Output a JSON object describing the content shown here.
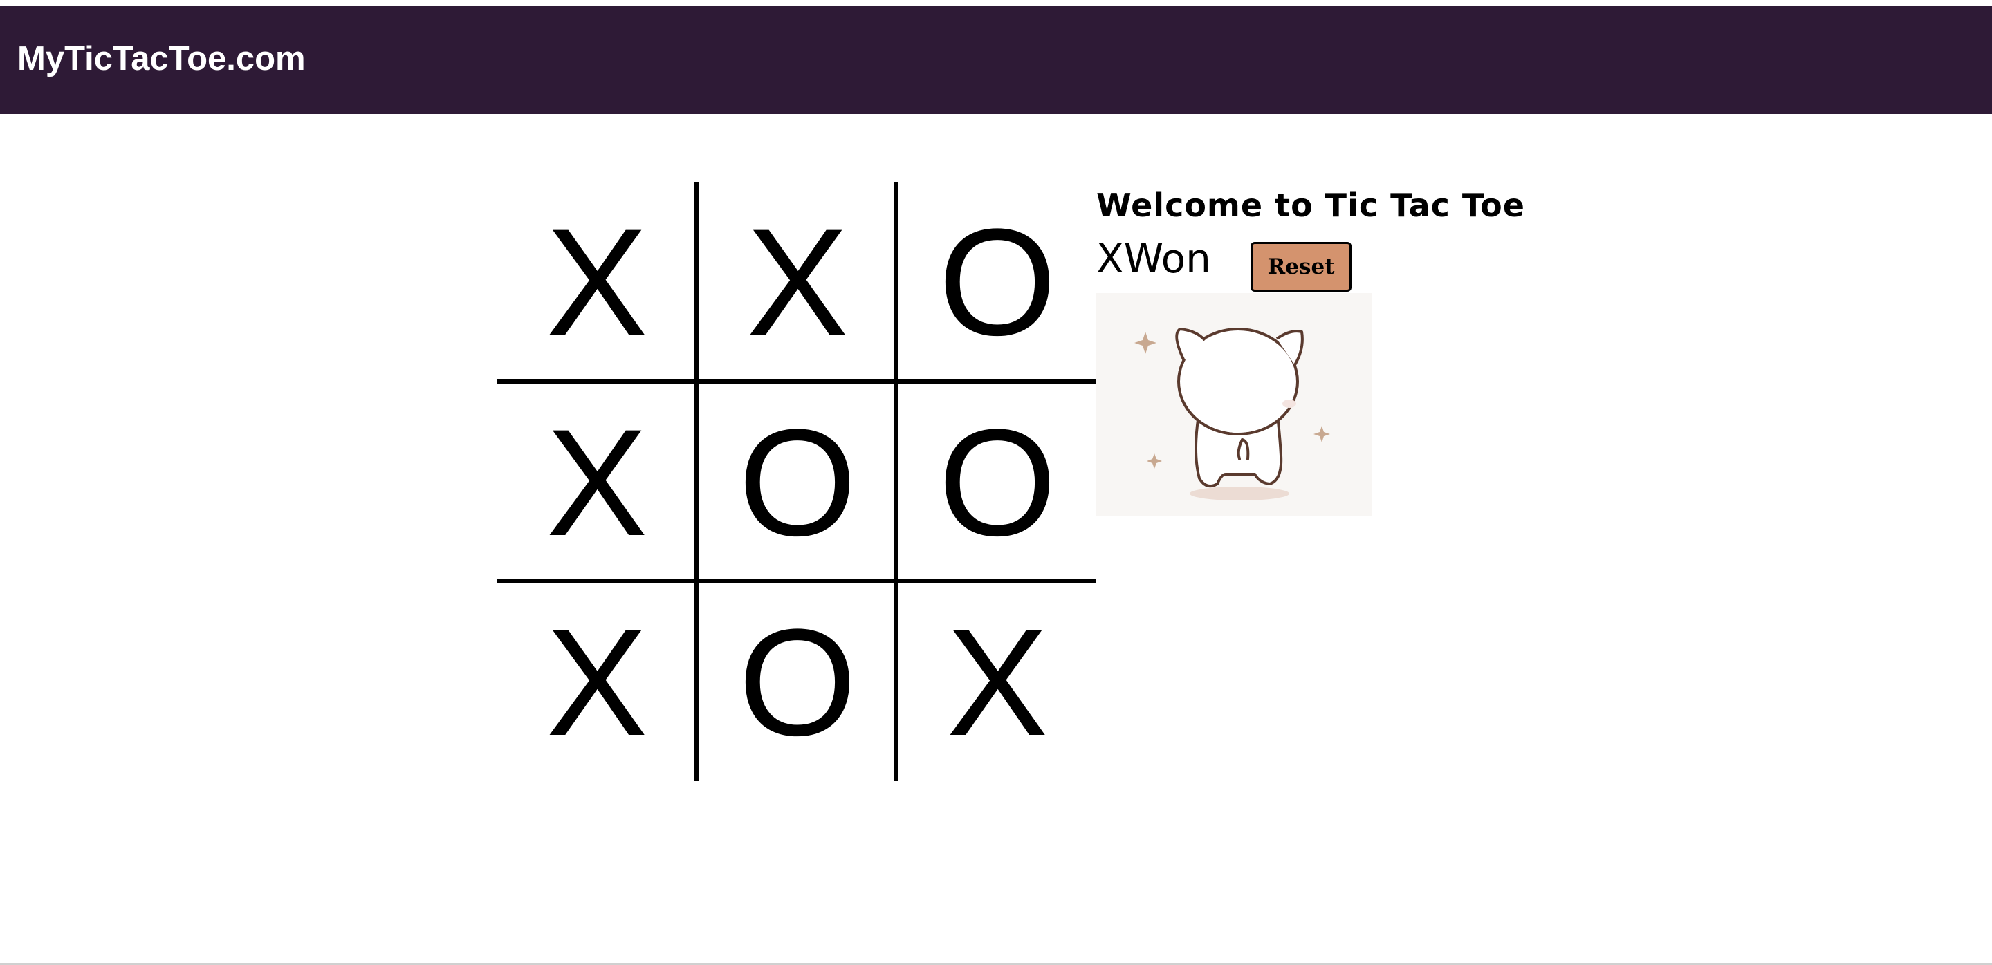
{
  "header": {
    "brand": "MyTicTacToe.com",
    "background_color": "#2e1a36",
    "text_color": "#ffffff"
  },
  "game": {
    "welcome_text": "Welcome to Tic Tac Toe",
    "status_text": "XWon",
    "reset_label": "Reset",
    "reset_color": "#d4936e",
    "board": [
      [
        "X",
        "X",
        "O"
      ],
      [
        "X",
        "O",
        "O"
      ],
      [
        "X",
        "O",
        "X"
      ]
    ],
    "image": "cat-celebration-icon"
  }
}
